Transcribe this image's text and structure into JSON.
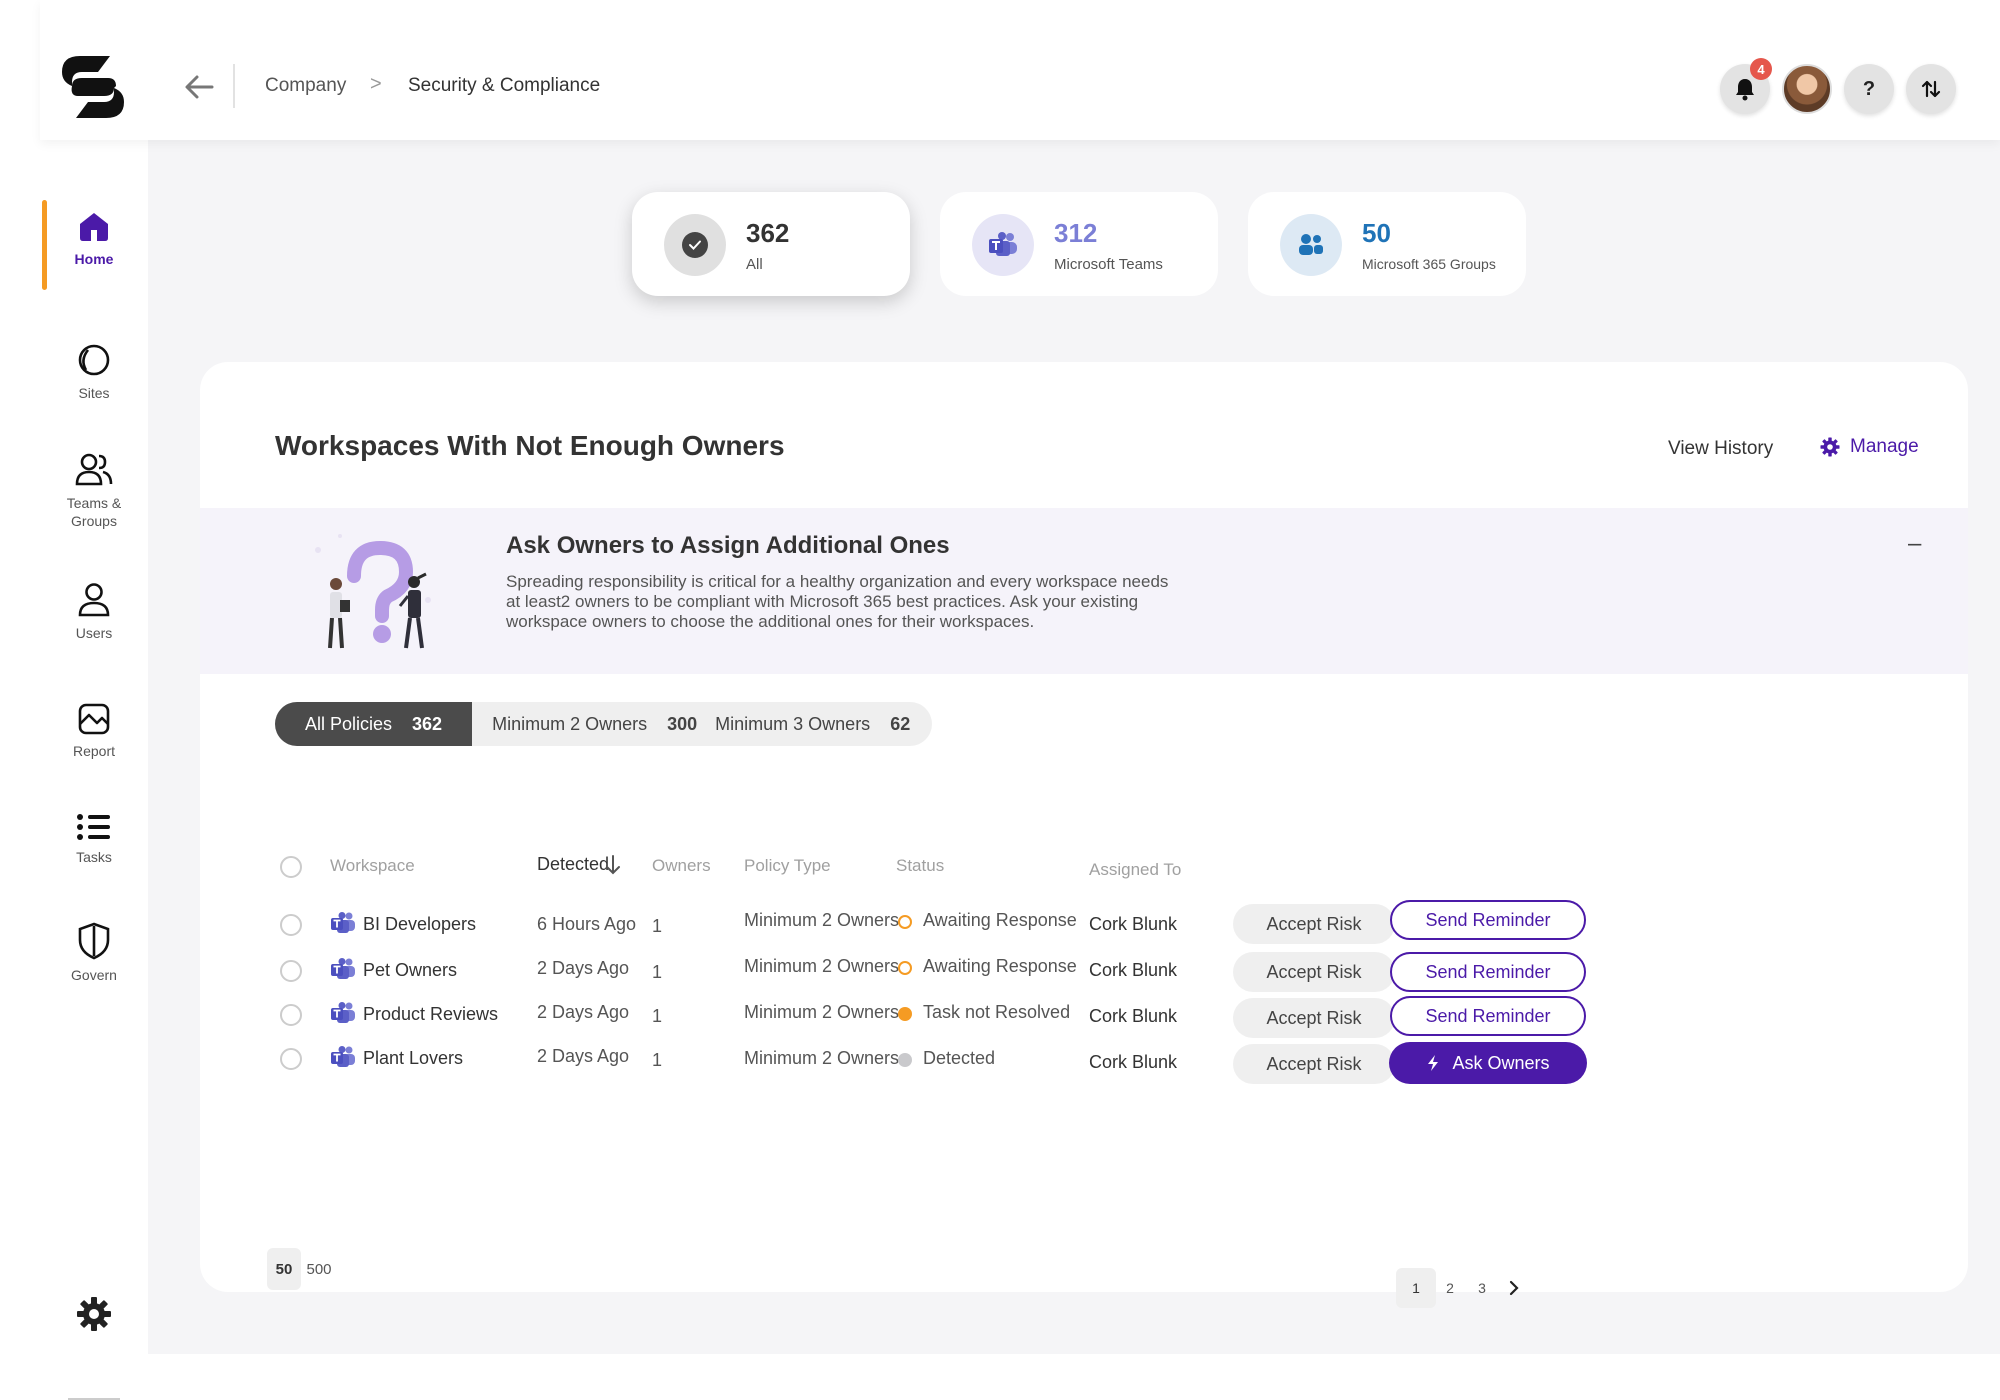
{
  "topbar": {
    "breadcrumb": [
      "Company",
      "Security & Compliance"
    ],
    "breadcrumb_separator": ">",
    "notifications_count": "4",
    "help_label": "?"
  },
  "sidebar": {
    "items": [
      {
        "label": "Home",
        "icon": "home-icon",
        "active": true
      },
      {
        "label": "Sites",
        "icon": "sites-icon"
      },
      {
        "label": "Teams & Groups",
        "icon": "teams-groups-icon"
      },
      {
        "label": "Users",
        "icon": "user-icon"
      },
      {
        "label": "Report",
        "icon": "report-icon"
      },
      {
        "label": "Tasks",
        "icon": "tasks-icon"
      },
      {
        "label": "Govern",
        "icon": "shield-icon"
      }
    ],
    "settings_icon": "gear-icon",
    "accent_color": "#f59b23"
  },
  "stats": [
    {
      "value": "362",
      "label": "All",
      "selected": true,
      "color": "#333333"
    },
    {
      "value": "312",
      "label": "Microsoft Teams",
      "color": "#7b7fd6"
    },
    {
      "value": "50",
      "label": "Microsoft 365 Groups",
      "color": "#1f73b7"
    }
  ],
  "panel": {
    "title": "Workspaces With Not Enough Owners",
    "view_history": "View History",
    "manage": "Manage",
    "banner": {
      "title": "Ask Owners to Assign Additional Ones",
      "text": "Spreading responsibility is critical for a healthy organization and every workspace needs at least2 owners to be compliant with Microsoft 365 best practices. Ask your existing workspace owners to choose the additional ones for their workspaces.",
      "collapse": "–"
    },
    "filters": [
      {
        "label": "All Policies",
        "count": "362",
        "active": true
      },
      {
        "label": "Minimum 2 Owners",
        "count": "300"
      },
      {
        "label": "Minimum 3 Owners",
        "count": "62"
      }
    ]
  },
  "table": {
    "headers": {
      "workspace": "Workspace",
      "detected": "Detected",
      "owners": "Owners",
      "policy_type": "Policy Type",
      "status": "Status",
      "assigned_to": "Assigned To"
    },
    "rows": [
      {
        "workspace": "BI Developers",
        "detected": "6 Hours Ago",
        "owners": "1",
        "policy": "Minimum 2 Owners",
        "status": "Awaiting Response",
        "status_kind": "awaiting",
        "assigned": "Cork Blunk",
        "accept": "Accept Risk",
        "action": "Send Reminder"
      },
      {
        "workspace": "Pet Owners",
        "detected": "2 Days Ago",
        "owners": "1",
        "policy": "Minimum 2 Owners",
        "status": "Awaiting Response",
        "status_kind": "awaiting",
        "assigned": "Cork Blunk",
        "accept": "Accept Risk",
        "action": "Send Reminder"
      },
      {
        "workspace": "Product Reviews",
        "detected": "2 Days Ago",
        "owners": "1",
        "policy": "Minimum 2 Owners",
        "status": "Task not Resolved",
        "status_kind": "unresolved",
        "assigned": "Cork Blunk",
        "accept": "Accept Risk",
        "action": "Send Reminder"
      },
      {
        "workspace": "Plant Lovers",
        "detected": "2 Days Ago",
        "owners": "1",
        "policy": "Minimum 2 Owners",
        "status": "Detected",
        "status_kind": "detected",
        "assigned": "Cork Blunk",
        "accept": "Accept Risk",
        "action": "Ask Owners"
      }
    ]
  },
  "pagination": {
    "page_sizes": [
      "50",
      "500"
    ],
    "pages": [
      "1",
      "2",
      "3"
    ],
    "current_page": "1",
    "next": "›"
  },
  "colors": {
    "primary": "#4b1aa8",
    "status_awaiting": "#f59b23",
    "status_unresolved": "#f59b23",
    "status_detected": "#c9c9cc"
  }
}
